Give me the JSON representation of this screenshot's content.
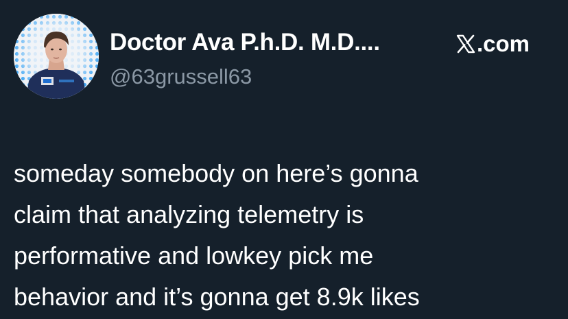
{
  "author": {
    "display_name": "Doctor Ava P.h.D. M.D....",
    "handle": "@63grussell63"
  },
  "source": {
    "icon": "x-logo-icon",
    "label": ".com"
  },
  "tweet": {
    "lines": [
      "someday somebody on here’s gonna",
      "claim that analyzing telemetry is",
      "performative and lowkey pick me",
      "behavior and it’s gonna get 8.9k likes"
    ]
  },
  "colors": {
    "background": "#15202b",
    "text_primary": "#ffffff",
    "text_secondary": "#8b98a5",
    "avatar_dots": "#2a9df4"
  }
}
